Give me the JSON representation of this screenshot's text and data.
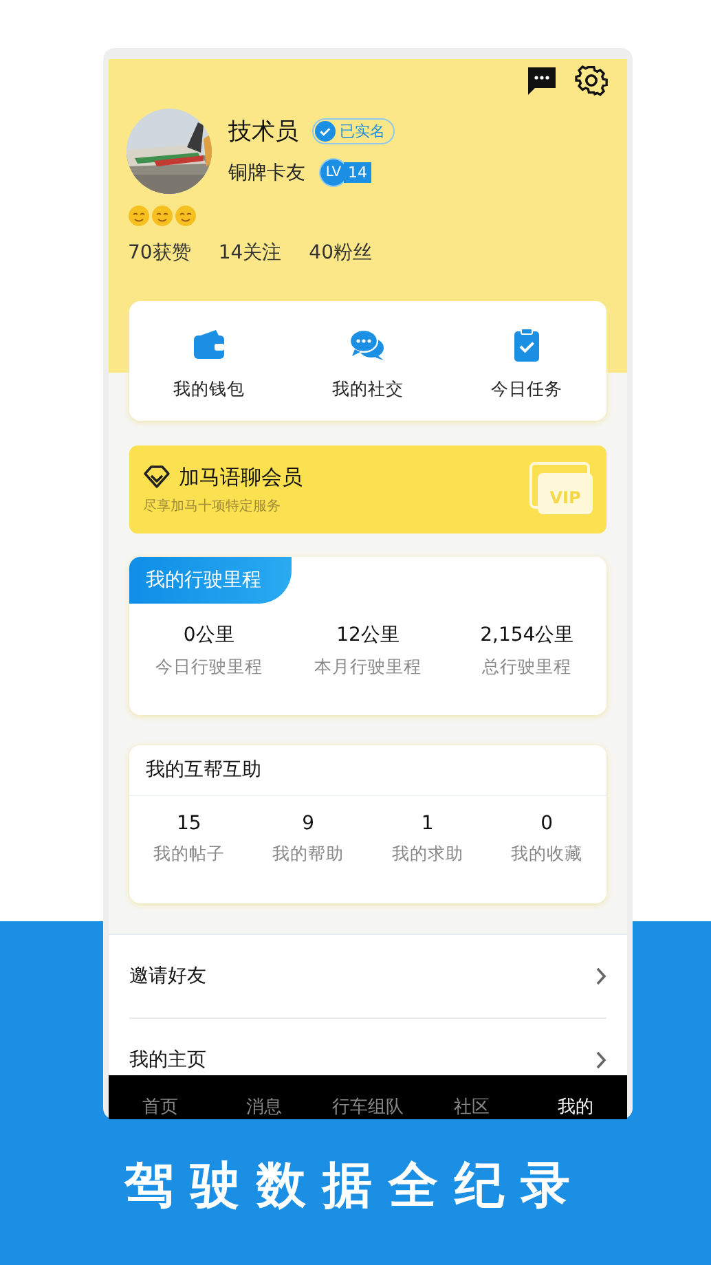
{
  "profile": {
    "name": "技术员",
    "verified_badge": "已实名",
    "title": "铜牌卡友",
    "level_tag": "LV",
    "level_number": "14",
    "stats": [
      "70获赞",
      "14关注",
      "40粉丝"
    ]
  },
  "shortcuts": [
    {
      "kind": "wallet",
      "label": "我的钱包"
    },
    {
      "kind": "chat",
      "label": "我的社交"
    },
    {
      "kind": "task",
      "label": "今日任务"
    }
  ],
  "vip": {
    "title": "加马语聊会员",
    "subtitle": "尽享加马十项特定服务",
    "tag": "VIP"
  },
  "mileage": {
    "title": "我的行驶里程",
    "items": [
      {
        "value": "0公里",
        "label": "今日行驶里程"
      },
      {
        "value": "12公里",
        "label": "本月行驶里程"
      },
      {
        "value": "2,154公里",
        "label": "总行驶里程"
      }
    ]
  },
  "mutual_help": {
    "title": "我的互帮互助",
    "items": [
      {
        "value": "15",
        "label": "我的帖子"
      },
      {
        "value": "9",
        "label": "我的帮助"
      },
      {
        "value": "1",
        "label": "我的求助"
      },
      {
        "value": "0",
        "label": "我的收藏"
      }
    ]
  },
  "menu": [
    "邀请好友",
    "我的主页"
  ],
  "tabs": [
    {
      "label": "首页",
      "selected": false
    },
    {
      "label": "消息",
      "selected": false
    },
    {
      "label": "行车组队",
      "selected": false
    },
    {
      "label": "社区",
      "selected": false
    },
    {
      "label": "我的",
      "selected": true
    }
  ],
  "caption": "驾驶数据全纪录"
}
